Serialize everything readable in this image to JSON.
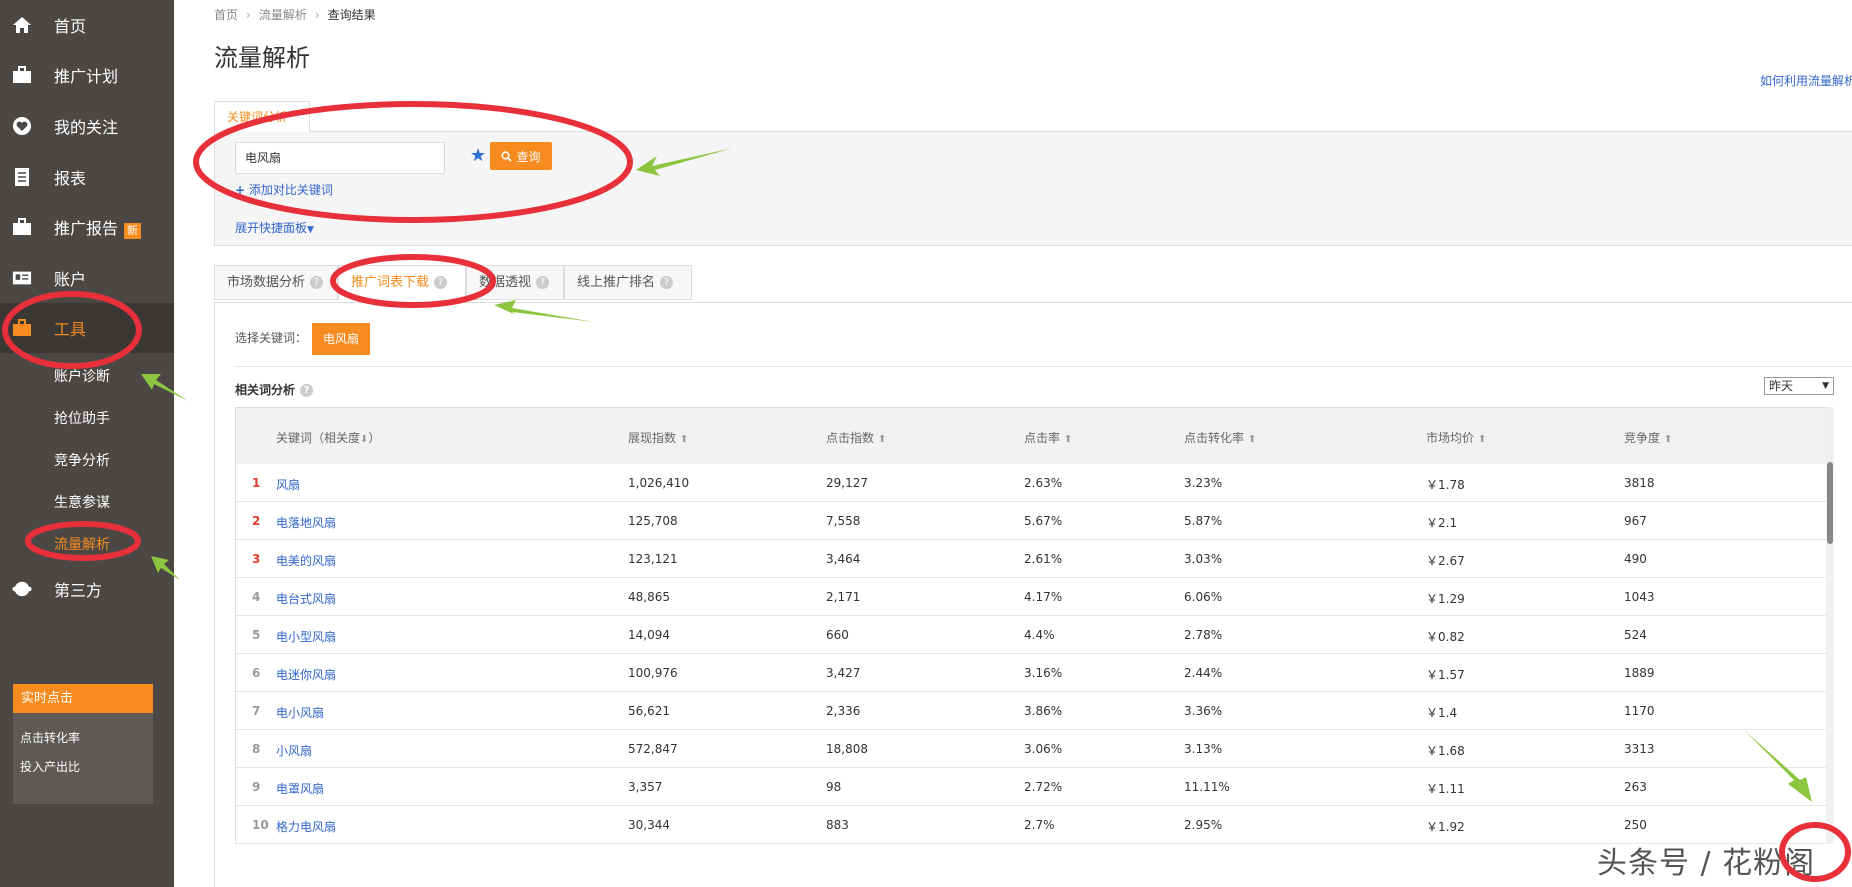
{
  "sidebar": {
    "items": [
      {
        "label": "首页",
        "icon": "home-icon",
        "badge": ""
      },
      {
        "label": "推广计划",
        "icon": "briefcase-icon",
        "badge": ""
      },
      {
        "label": "我的关注",
        "icon": "heart-icon",
        "badge": ""
      },
      {
        "label": "报表",
        "icon": "receipt-icon",
        "badge": ""
      },
      {
        "label": "推广报告",
        "icon": "briefcase-icon",
        "badge": "新"
      },
      {
        "label": "账户",
        "icon": "id-card-icon",
        "badge": ""
      },
      {
        "label": "工具",
        "icon": "toolbox-icon",
        "badge": ""
      },
      {
        "label": "第三方",
        "icon": "puzzle-icon",
        "badge": ""
      }
    ],
    "sub_items": [
      "账户诊断",
      "抢位助手",
      "竞争分析",
      "生意参谋",
      "流量解析"
    ],
    "realtime": {
      "title": "实时点击",
      "items": [
        "点击转化率",
        "投入产出比"
      ]
    }
  },
  "breadcrumb": [
    "首页",
    "流量解析",
    "查询结果"
  ],
  "page_title": "流量解析",
  "help_link": "如何利用流量解析",
  "search": {
    "tab_label": "关键词分析",
    "input_value": "电风扇",
    "query_label": "查询",
    "add_compare": "添加对比关键词",
    "expand_panel": "展开快捷面板"
  },
  "tabs": [
    "市场数据分析",
    "推广词表下载",
    "数据透视",
    "线上推广排名"
  ],
  "select_label": "选择关键词：",
  "selected_keyword": "电风扇",
  "section_title": "相关词分析",
  "date_option": "昨天",
  "table": {
    "headers": [
      "关键词（相关度",
      "展现指数",
      "点击指数",
      "点击率",
      "点击转化率",
      "市场均价",
      "竞争度"
    ],
    "header_suffix": "）",
    "rows": [
      {
        "rank": "1",
        "keyword": "风扇",
        "impressions": "1,026,410",
        "clicks": "29,127",
        "ctr": "2.63%",
        "cvr": "3.23%",
        "price": "￥1.78",
        "competition": "3818"
      },
      {
        "rank": "2",
        "keyword": "电落地风扇",
        "impressions": "125,708",
        "clicks": "7,558",
        "ctr": "5.67%",
        "cvr": "5.87%",
        "price": "￥2.1",
        "competition": "967"
      },
      {
        "rank": "3",
        "keyword": "电美的风扇",
        "impressions": "123,121",
        "clicks": "3,464",
        "ctr": "2.61%",
        "cvr": "3.03%",
        "price": "￥2.67",
        "competition": "490"
      },
      {
        "rank": "4",
        "keyword": "电台式风扇",
        "impressions": "48,865",
        "clicks": "2,171",
        "ctr": "4.17%",
        "cvr": "6.06%",
        "price": "￥1.29",
        "competition": "1043"
      },
      {
        "rank": "5",
        "keyword": "电小型风扇",
        "impressions": "14,094",
        "clicks": "660",
        "ctr": "4.4%",
        "cvr": "2.78%",
        "price": "￥0.82",
        "competition": "524"
      },
      {
        "rank": "6",
        "keyword": "电迷你风扇",
        "impressions": "100,976",
        "clicks": "3,427",
        "ctr": "3.16%",
        "cvr": "2.44%",
        "price": "￥1.57",
        "competition": "1889"
      },
      {
        "rank": "7",
        "keyword": "电小风扇",
        "impressions": "56,621",
        "clicks": "2,336",
        "ctr": "3.86%",
        "cvr": "3.36%",
        "price": "￥1.4",
        "competition": "1170"
      },
      {
        "rank": "8",
        "keyword": "小风扇",
        "impressions": "572,847",
        "clicks": "18,808",
        "ctr": "3.06%",
        "cvr": "3.13%",
        "price": "￥1.68",
        "competition": "3313"
      },
      {
        "rank": "9",
        "keyword": "电罩风扇",
        "impressions": "3,357",
        "clicks": "98",
        "ctr": "2.72%",
        "cvr": "11.11%",
        "price": "￥1.11",
        "competition": "263"
      },
      {
        "rank": "10",
        "keyword": "格力电风扇",
        "impressions": "30,344",
        "clicks": "883",
        "ctr": "2.7%",
        "cvr": "2.95%",
        "price": "￥1.92",
        "competition": "250"
      }
    ]
  },
  "watermark": "头条号 / 花粉阁",
  "colors": {
    "accent": "#f68b1f",
    "sidebar": "#4a4745",
    "link": "#3366cc",
    "annotation_red": "#e8303a",
    "annotation_green": "#8cc63f"
  }
}
